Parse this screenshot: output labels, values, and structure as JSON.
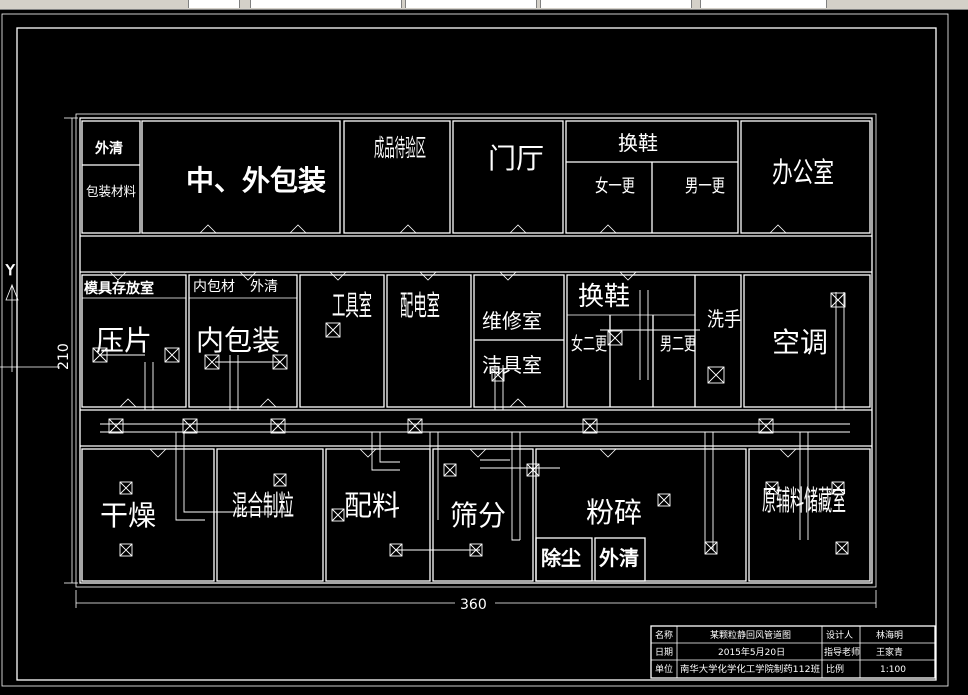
{
  "rooms": {
    "wai_qing_top": "外清",
    "bao_zhuang_cai_liao": "包装材料",
    "zhong_wai_bao_zhuang": "中、外包装",
    "cheng_pin": "成品待验区",
    "men_ting": "门厅",
    "huan_xie_top": "换鞋",
    "nv_yi_geng": "女一更",
    "nan_yi_geng": "男一更",
    "ban_gong_shi": "办公室",
    "mo_ju": "模具存放室",
    "nei_bao_cai": "内包材",
    "wai_qing_mid": "外清",
    "ya_pian": "压片",
    "nei_bao_zhuang": "内包装",
    "gong_ju_shi": "工具室",
    "pei_dian_shi": "配电室",
    "wei_xiu_shi": "维修室",
    "jie_ju_shi": "洁具室",
    "huan_xie_mid": "换鞋",
    "nv_er_geng": "女二更",
    "nan_er_geng": "男二更",
    "xi_shou": "洗手",
    "kong_tiao": "空调",
    "gan_zao": "干燥",
    "hun_he_zhi_li": "混合制粒",
    "pei_liao": "配料",
    "shai_fen": "筛分",
    "fen_sui": "粉碎",
    "chu_chen": "除尘",
    "wai_qing_bottom": "外清",
    "yuan_fu_liao": "原辅料储藏室"
  },
  "dimensions": {
    "width_label": "360",
    "height_label": "210"
  },
  "axis": {
    "y_label": "Y"
  },
  "title_block": {
    "name_label": "名称",
    "name_value": "某颗粒静回风管道图",
    "designer_label": "设计人",
    "designer_value": "林海明",
    "date_label": "日期",
    "date_value": "2015年5月20日",
    "advisor_label": "指导老师",
    "advisor_value": "王家青",
    "unit_label": "单位",
    "unit_value": "南华大学化学化工学院制药112班",
    "scale_label": "比例",
    "scale_value": "1:100"
  }
}
